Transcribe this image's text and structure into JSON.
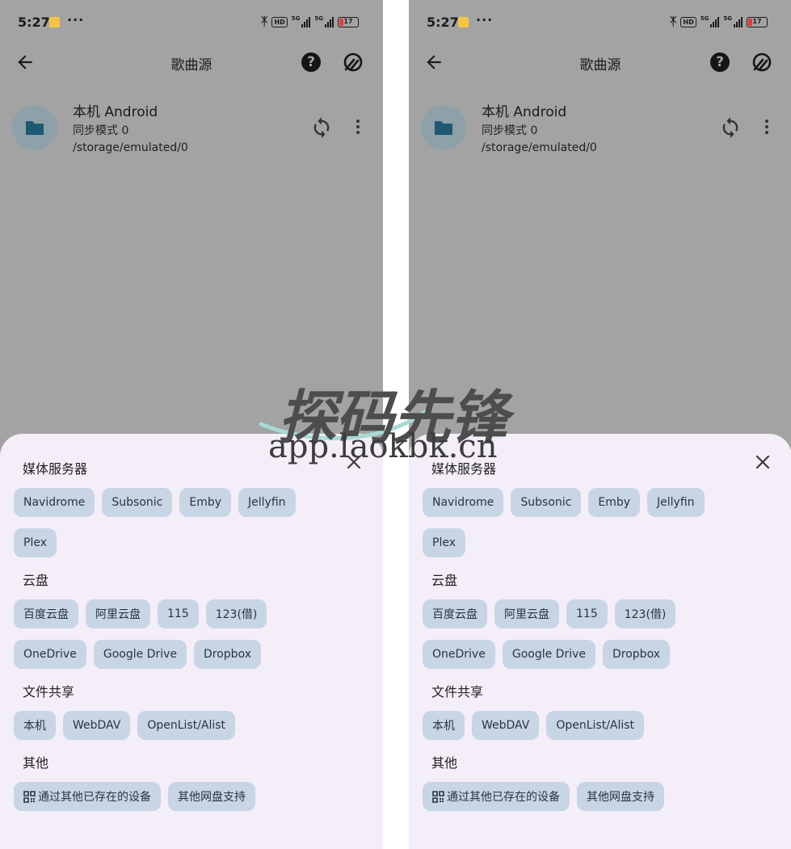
{
  "status_bar": {
    "time": "5:27",
    "dots": "···",
    "hd": "HD",
    "net1": "5G",
    "net2": "5G",
    "battery": "17"
  },
  "app_bar": {
    "title": "歌曲源"
  },
  "source": {
    "name": "本机 Android",
    "mode": "同步模式 0",
    "path": "/storage/emulated/0"
  },
  "sections": [
    {
      "title": "媒体服务器",
      "rows": [
        [
          "Navidrome",
          "Subsonic",
          "Emby",
          "Jellyfin"
        ],
        [
          "Plex"
        ]
      ]
    },
    {
      "title": "云盘",
      "rows": [
        [
          "百度云盘",
          "阿里云盘",
          "115",
          "123(借)"
        ],
        [
          "OneDrive",
          "Google Drive",
          "Dropbox"
        ]
      ]
    },
    {
      "title": "文件共享",
      "rows": [
        [
          "本机",
          "WebDAV",
          "OpenList/Alist"
        ]
      ]
    },
    {
      "title": "其他",
      "rows": [
        [
          "通过其他已存在的设备",
          "其他网盘支持"
        ]
      ]
    }
  ],
  "watermark": {
    "title": "探码先锋",
    "url": "app.laokbk.cn"
  },
  "colors": {
    "overlay": "#a3a3a3",
    "sheet": "#f4eef9",
    "chip": "#c8d5e5"
  }
}
